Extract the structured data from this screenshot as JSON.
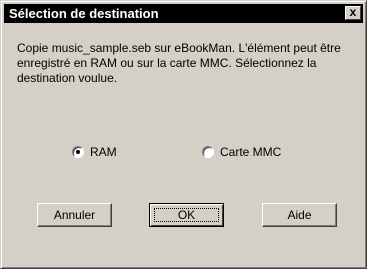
{
  "dialog": {
    "title": "Sélection de destination",
    "close_label": "x",
    "message": "Copie music_sample.seb sur eBookMan. L'élément peut être enregistré en RAM ou sur la carte MMC. Sélectionnez la destination voulue."
  },
  "options": {
    "ram": {
      "label": "RAM",
      "selected": true
    },
    "mmc": {
      "label": "Carte MMC",
      "selected": false
    }
  },
  "buttons": {
    "cancel": "Annuler",
    "ok": "OK",
    "help": "Aide"
  }
}
